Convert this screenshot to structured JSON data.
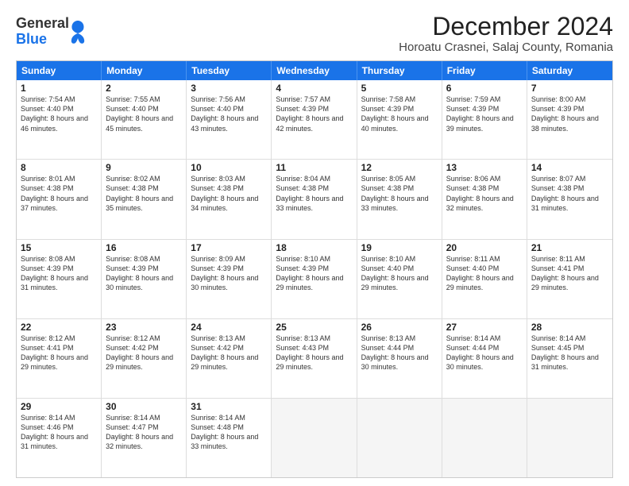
{
  "header": {
    "logo_general": "General",
    "logo_blue": "Blue",
    "title": "December 2024",
    "subtitle": "Horoatu Crasnei, Salaj County, Romania"
  },
  "calendar": {
    "days_of_week": [
      "Sunday",
      "Monday",
      "Tuesday",
      "Wednesday",
      "Thursday",
      "Friday",
      "Saturday"
    ],
    "weeks": [
      [
        {
          "day": "1",
          "sunrise": "7:54 AM",
          "sunset": "4:40 PM",
          "daylight": "8 hours and 46 minutes."
        },
        {
          "day": "2",
          "sunrise": "7:55 AM",
          "sunset": "4:40 PM",
          "daylight": "8 hours and 45 minutes."
        },
        {
          "day": "3",
          "sunrise": "7:56 AM",
          "sunset": "4:40 PM",
          "daylight": "8 hours and 43 minutes."
        },
        {
          "day": "4",
          "sunrise": "7:57 AM",
          "sunset": "4:39 PM",
          "daylight": "8 hours and 42 minutes."
        },
        {
          "day": "5",
          "sunrise": "7:58 AM",
          "sunset": "4:39 PM",
          "daylight": "8 hours and 40 minutes."
        },
        {
          "day": "6",
          "sunrise": "7:59 AM",
          "sunset": "4:39 PM",
          "daylight": "8 hours and 39 minutes."
        },
        {
          "day": "7",
          "sunrise": "8:00 AM",
          "sunset": "4:39 PM",
          "daylight": "8 hours and 38 minutes."
        }
      ],
      [
        {
          "day": "8",
          "sunrise": "8:01 AM",
          "sunset": "4:38 PM",
          "daylight": "8 hours and 37 minutes."
        },
        {
          "day": "9",
          "sunrise": "8:02 AM",
          "sunset": "4:38 PM",
          "daylight": "8 hours and 35 minutes."
        },
        {
          "day": "10",
          "sunrise": "8:03 AM",
          "sunset": "4:38 PM",
          "daylight": "8 hours and 34 minutes."
        },
        {
          "day": "11",
          "sunrise": "8:04 AM",
          "sunset": "4:38 PM",
          "daylight": "8 hours and 33 minutes."
        },
        {
          "day": "12",
          "sunrise": "8:05 AM",
          "sunset": "4:38 PM",
          "daylight": "8 hours and 33 minutes."
        },
        {
          "day": "13",
          "sunrise": "8:06 AM",
          "sunset": "4:38 PM",
          "daylight": "8 hours and 32 minutes."
        },
        {
          "day": "14",
          "sunrise": "8:07 AM",
          "sunset": "4:38 PM",
          "daylight": "8 hours and 31 minutes."
        }
      ],
      [
        {
          "day": "15",
          "sunrise": "8:08 AM",
          "sunset": "4:39 PM",
          "daylight": "8 hours and 31 minutes."
        },
        {
          "day": "16",
          "sunrise": "8:08 AM",
          "sunset": "4:39 PM",
          "daylight": "8 hours and 30 minutes."
        },
        {
          "day": "17",
          "sunrise": "8:09 AM",
          "sunset": "4:39 PM",
          "daylight": "8 hours and 30 minutes."
        },
        {
          "day": "18",
          "sunrise": "8:10 AM",
          "sunset": "4:39 PM",
          "daylight": "8 hours and 29 minutes."
        },
        {
          "day": "19",
          "sunrise": "8:10 AM",
          "sunset": "4:40 PM",
          "daylight": "8 hours and 29 minutes."
        },
        {
          "day": "20",
          "sunrise": "8:11 AM",
          "sunset": "4:40 PM",
          "daylight": "8 hours and 29 minutes."
        },
        {
          "day": "21",
          "sunrise": "8:11 AM",
          "sunset": "4:41 PM",
          "daylight": "8 hours and 29 minutes."
        }
      ],
      [
        {
          "day": "22",
          "sunrise": "8:12 AM",
          "sunset": "4:41 PM",
          "daylight": "8 hours and 29 minutes."
        },
        {
          "day": "23",
          "sunrise": "8:12 AM",
          "sunset": "4:42 PM",
          "daylight": "8 hours and 29 minutes."
        },
        {
          "day": "24",
          "sunrise": "8:13 AM",
          "sunset": "4:42 PM",
          "daylight": "8 hours and 29 minutes."
        },
        {
          "day": "25",
          "sunrise": "8:13 AM",
          "sunset": "4:43 PM",
          "daylight": "8 hours and 29 minutes."
        },
        {
          "day": "26",
          "sunrise": "8:13 AM",
          "sunset": "4:44 PM",
          "daylight": "8 hours and 30 minutes."
        },
        {
          "day": "27",
          "sunrise": "8:14 AM",
          "sunset": "4:44 PM",
          "daylight": "8 hours and 30 minutes."
        },
        {
          "day": "28",
          "sunrise": "8:14 AM",
          "sunset": "4:45 PM",
          "daylight": "8 hours and 31 minutes."
        }
      ],
      [
        {
          "day": "29",
          "sunrise": "8:14 AM",
          "sunset": "4:46 PM",
          "daylight": "8 hours and 31 minutes."
        },
        {
          "day": "30",
          "sunrise": "8:14 AM",
          "sunset": "4:47 PM",
          "daylight": "8 hours and 32 minutes."
        },
        {
          "day": "31",
          "sunrise": "8:14 AM",
          "sunset": "4:48 PM",
          "daylight": "8 hours and 33 minutes."
        },
        null,
        null,
        null,
        null
      ]
    ]
  }
}
